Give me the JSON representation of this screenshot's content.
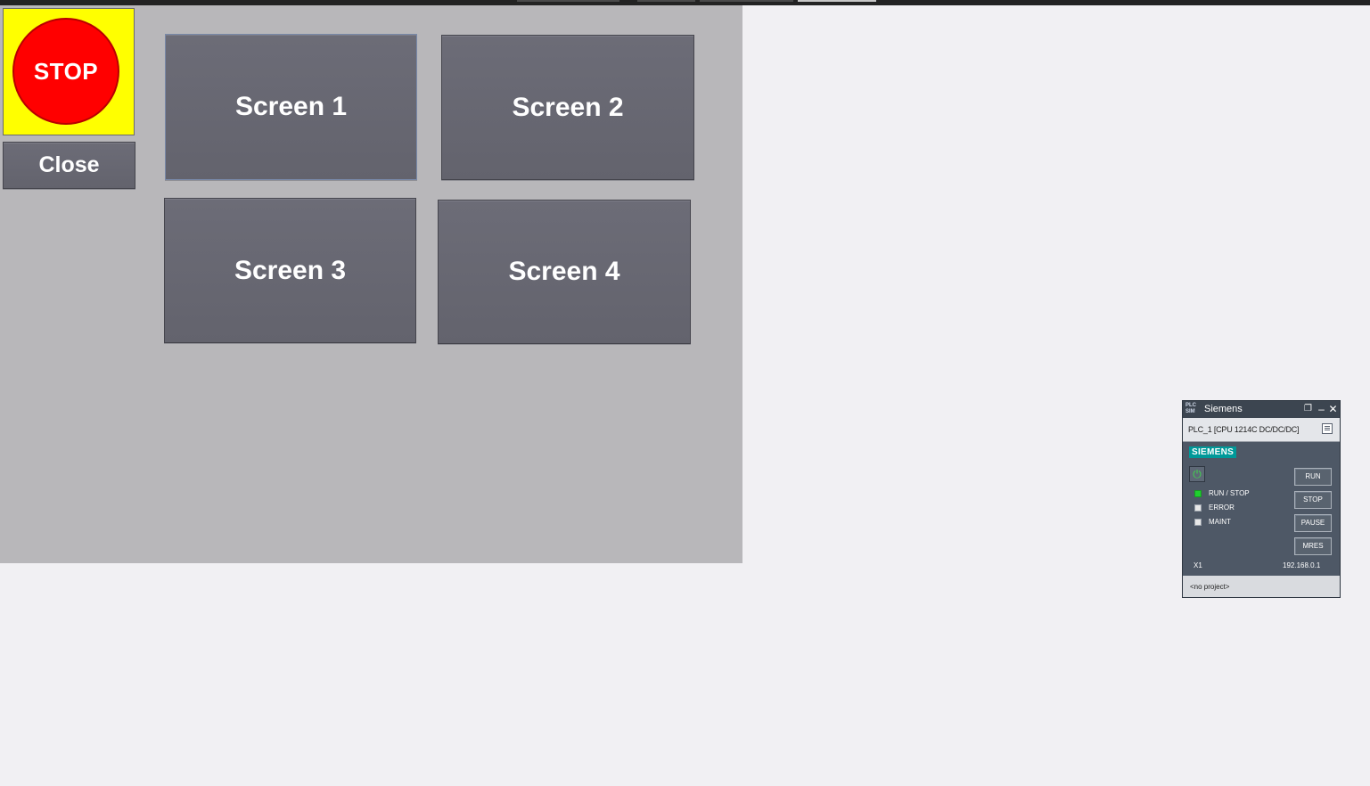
{
  "hmi": {
    "stop_label": "STOP",
    "close_label": "Close",
    "screens": [
      "Screen 1",
      "Screen 2",
      "Screen 3",
      "Screen 4"
    ]
  },
  "plcsim": {
    "title": "Siemens",
    "app_icon": "PLC SIM",
    "device": "PLC_1 [CPU 1214C DC/DC/DC]",
    "brand": "SIEMENS",
    "leds": [
      {
        "label": "RUN / STOP",
        "state": "green"
      },
      {
        "label": "ERROR",
        "state": "off"
      },
      {
        "label": "MAINT",
        "state": "off"
      }
    ],
    "buttons": [
      "RUN",
      "STOP",
      "PAUSE",
      "MRES"
    ],
    "interface": "X1",
    "ip": "192.168.0.1",
    "project": "<no project>"
  },
  "colors": {
    "stop_background": "#ffff00",
    "stop_circle": "#ff0000",
    "hmi_background": "#b8b7ba",
    "button_face": "#666670",
    "siemens_teal": "#009999",
    "led_green": "#1fcf2e"
  },
  "icons": {
    "restore": "restore-icon",
    "minimize": "minimize-icon",
    "close": "close-icon",
    "power": "power-icon",
    "device": "device-properties-icon"
  }
}
